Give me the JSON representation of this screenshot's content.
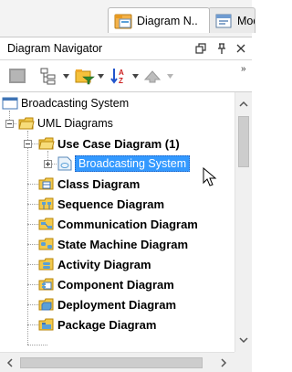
{
  "tabs": [
    {
      "label": "Diagram N..",
      "icon": "diagram-navigator-icon",
      "active": true
    },
    {
      "label": "Model Exp..",
      "icon": "model-explorer-icon",
      "active": false
    }
  ],
  "panel": {
    "title": "Diagram Navigator",
    "controls": [
      "restore-icon",
      "pin-icon",
      "close-icon"
    ]
  },
  "toolbar": {
    "buttons": [
      "new-diagram-icon",
      "tree-view-icon",
      "filter-icon",
      "sort-icon",
      "navigate-up-icon"
    ],
    "overflow": "»"
  },
  "tree": {
    "root": "Broadcasting System",
    "group": "UML Diagrams",
    "expanded_type": "Use Case Diagram (1)",
    "selected_item": "Broadcasting System",
    "diagram_types": [
      "Class Diagram",
      "Sequence Diagram",
      "Communication Diagram",
      "State Machine Diagram",
      "Activity Diagram",
      "Component Diagram",
      "Deployment Diagram",
      "Package Diagram"
    ]
  },
  "colors": {
    "selection": "#3399ff",
    "folder": "#f2c94c",
    "diagram_icon": "#5aa0d8"
  }
}
